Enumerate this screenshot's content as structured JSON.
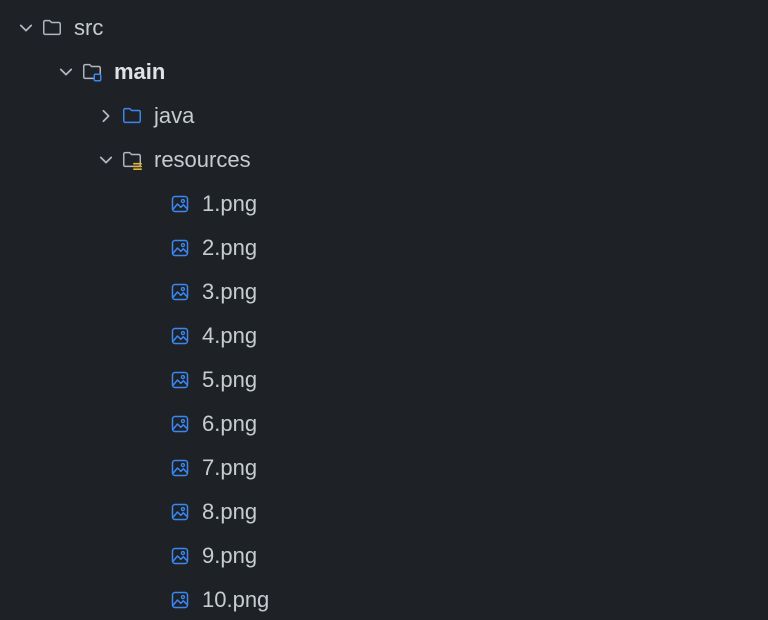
{
  "colors": {
    "bg": "#1e2227",
    "text": "#c7ccd1",
    "folderGray": "#b2b8be",
    "blue": "#3a87f2",
    "yellow": "#e2b33a"
  },
  "tree": {
    "src": {
      "label": "src",
      "expanded": true,
      "type": "folder",
      "children": {
        "main": {
          "label": "main",
          "expanded": true,
          "type": "module-folder",
          "bold": true,
          "children": {
            "java": {
              "label": "java",
              "expanded": false,
              "type": "source-folder"
            },
            "resources": {
              "label": "resources",
              "expanded": true,
              "type": "resources-folder",
              "files": [
                {
                  "label": "1.png",
                  "type": "image"
                },
                {
                  "label": "2.png",
                  "type": "image"
                },
                {
                  "label": "3.png",
                  "type": "image"
                },
                {
                  "label": "4.png",
                  "type": "image"
                },
                {
                  "label": "5.png",
                  "type": "image"
                },
                {
                  "label": "6.png",
                  "type": "image"
                },
                {
                  "label": "7.png",
                  "type": "image"
                },
                {
                  "label": "8.png",
                  "type": "image"
                },
                {
                  "label": "9.png",
                  "type": "image"
                },
                {
                  "label": "10.png",
                  "type": "image"
                }
              ]
            }
          }
        }
      }
    }
  }
}
